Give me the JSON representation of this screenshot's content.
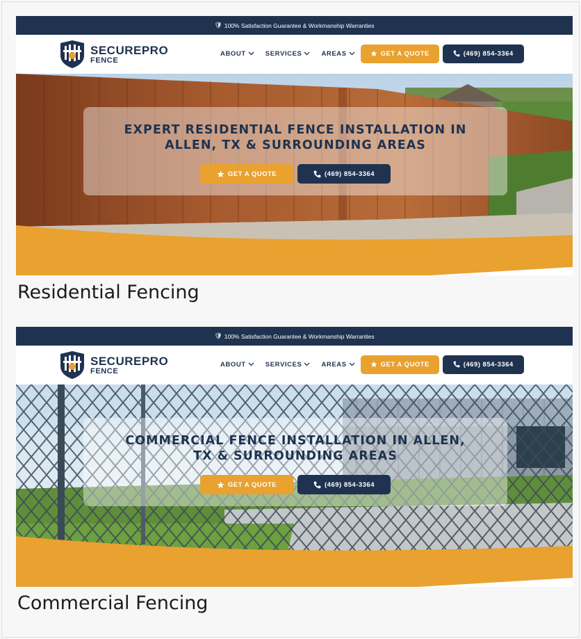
{
  "shots": [
    {
      "topbar": "100% Satisfaction Guarantee & Workmanship Warranties",
      "logo": {
        "line1": "SECUREPRO",
        "line2": "FENCE"
      },
      "menu": [
        "ABOUT",
        "SERVICES",
        "AREAS"
      ],
      "nav_quote": "GET A QUOTE",
      "nav_phone": "(469) 854-3364",
      "hero": {
        "title_line1": "EXPERT RESIDENTIAL FENCE INSTALLATION IN",
        "title_line2": "ALLEN, TX & SURROUNDING AREAS",
        "quote_label": "GET A QUOTE",
        "phone_label": "(469) 854-3364"
      },
      "caption": "Residential Fencing"
    },
    {
      "topbar": "100% Satisfaction Guarantee & Workmanship Warranties",
      "logo": {
        "line1": "SECUREPRO",
        "line2": "FENCE"
      },
      "menu": [
        "ABOUT",
        "SERVICES",
        "AREAS"
      ],
      "nav_quote": "GET A QUOTE",
      "nav_phone": "(469) 854-3364",
      "hero": {
        "title_line1": "COMMERCIAL FENCE INSTALLATION IN ALLEN,",
        "title_line2": "TX & SURROUNDING AREAS",
        "quote_label": "GET A QUOTE",
        "phone_label": "(469) 854-3364"
      },
      "caption": "Commercial Fencing"
    }
  ],
  "colors": {
    "navy": "#1f3350",
    "orange": "#e9a130",
    "white": "#ffffff"
  },
  "icons": [
    "shield-icon",
    "chevron-down-icon",
    "star-icon",
    "phone-icon",
    "logo-shield-icon"
  ]
}
